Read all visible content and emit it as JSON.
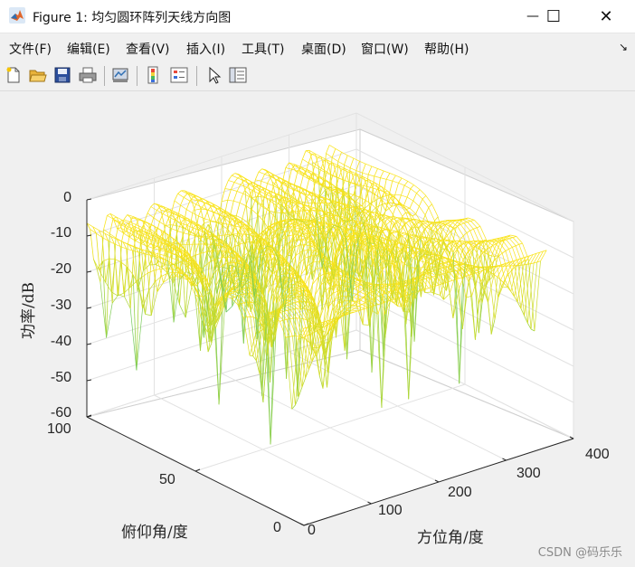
{
  "window": {
    "title": "Figure 1: 均匀圆环阵列天线方向图",
    "minimize_symbol": "—",
    "maximize_symbol": "☐",
    "close_symbol": "✕"
  },
  "menu": {
    "items": [
      {
        "label": "文件(F)"
      },
      {
        "label": "编辑(E)"
      },
      {
        "label": "查看(V)"
      },
      {
        "label": "插入(I)"
      },
      {
        "label": "工具(T)"
      },
      {
        "label": "桌面(D)"
      },
      {
        "label": "窗口(W)"
      },
      {
        "label": "帮助(H)"
      }
    ],
    "overflow_symbol": "↘"
  },
  "toolbar": {
    "icons": [
      "new-figure-icon",
      "open-file-icon",
      "save-icon",
      "print-icon",
      "link-plot-icon",
      "colorbar-icon",
      "legend-icon",
      "pointer-icon",
      "property-inspector-icon"
    ]
  },
  "chart_data": {
    "type": "surface",
    "xlabel": "方位角/度",
    "ylabel": "俯仰角/度",
    "zlabel": "功率/dB",
    "xticks": [
      "0",
      "100",
      "200",
      "300",
      "400"
    ],
    "yticks": [
      "0",
      "50",
      "100"
    ],
    "zticks": [
      "0",
      "-10",
      "-20",
      "-30",
      "-40",
      "-50",
      "-60"
    ],
    "xlim": [
      0,
      400
    ],
    "ylim": [
      0,
      100
    ],
    "zlim": [
      -60,
      0
    ],
    "colormap": [
      "#1a9f8e",
      "#5cc46a",
      "#b8d936",
      "#f7e21a",
      "#fde725"
    ],
    "grid": true
  },
  "watermark": "CSDN @码乐乐"
}
